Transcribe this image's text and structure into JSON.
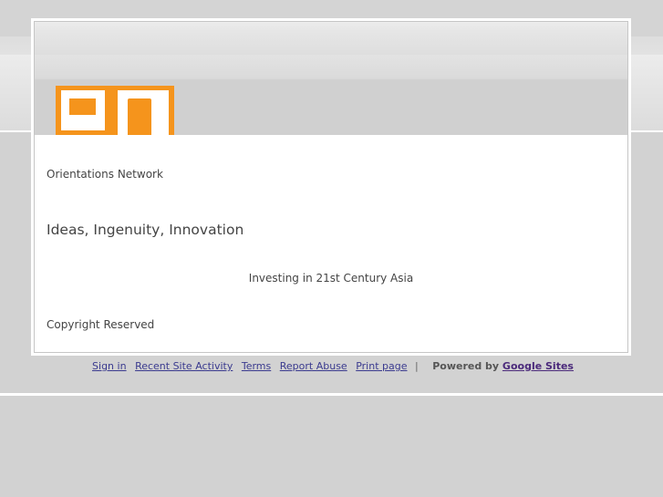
{
  "site": {
    "name": "Orientations Network",
    "tagline": "Ideas, Ingenuity, Innovation",
    "subtitle": "Investing in 21st Century Asia",
    "copyright": "Copyright Reserved",
    "logo_color": "#f5941c"
  },
  "footer": {
    "links": [
      "Sign in",
      "Recent Site Activity",
      "Terms",
      "Report Abuse",
      "Print page"
    ],
    "separator": "|",
    "powered_by": "Powered by",
    "powered_link": "Google Sites"
  }
}
